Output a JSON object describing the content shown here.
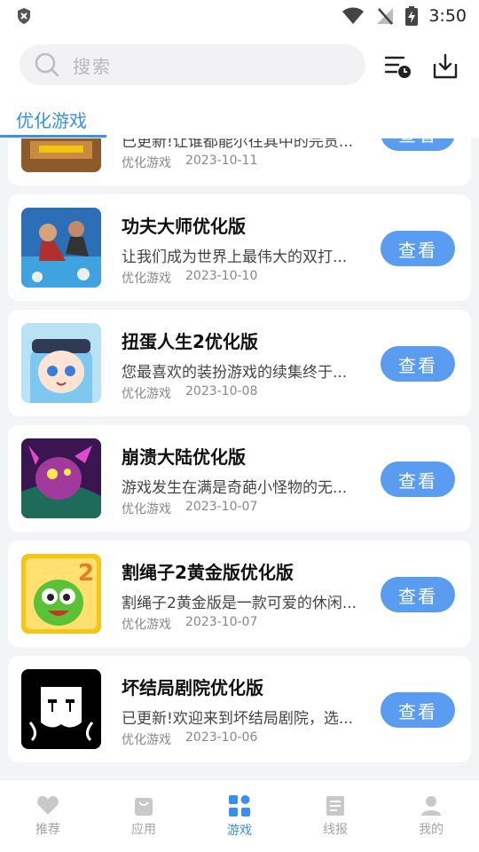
{
  "status_bar": {
    "time": "3:50"
  },
  "header": {
    "search_placeholder": "搜索",
    "active_tab": "优化游戏"
  },
  "games": [
    {
      "title": "",
      "desc": "已更新!让谁都能尔往其中的完贯...",
      "category": "优化游戏",
      "date": "2023-10-11",
      "button": "查看"
    },
    {
      "title": "功夫大师优化版",
      "desc": "让我们成为世界上最伟大的双打...",
      "category": "优化游戏",
      "date": "2023-10-10",
      "button": "查看"
    },
    {
      "title": "扭蛋人生2优化版",
      "desc": "您最喜欢的装扮游戏的续集终于...",
      "category": "优化游戏",
      "date": "2023-10-08",
      "button": "查看"
    },
    {
      "title": "崩溃大陆优化版",
      "desc": "游戏发生在满是奇葩小怪物的无...",
      "category": "优化游戏",
      "date": "2023-10-07",
      "button": "查看"
    },
    {
      "title": "割绳子2黄金版优化版",
      "desc": "割绳子2黄金版是一款可爱的休闲...",
      "category": "优化游戏",
      "date": "2023-10-07",
      "button": "查看"
    },
    {
      "title": "坏结局剧院优化版",
      "desc": "已更新!欢迎来到坏结局剧院，选...",
      "category": "优化游戏",
      "date": "2023-10-06",
      "button": "查看"
    }
  ],
  "bottom_nav": [
    {
      "label": "推荐",
      "icon": "heart-icon"
    },
    {
      "label": "应用",
      "icon": "bag-icon"
    },
    {
      "label": "游戏",
      "icon": "grid-icon",
      "active": true
    },
    {
      "label": "线报",
      "icon": "document-icon"
    },
    {
      "label": "我的",
      "icon": "user-icon"
    }
  ],
  "colors": {
    "accent": "#3a8fe6",
    "button": "#5a9cf0",
    "background": "#f3f4f6"
  }
}
